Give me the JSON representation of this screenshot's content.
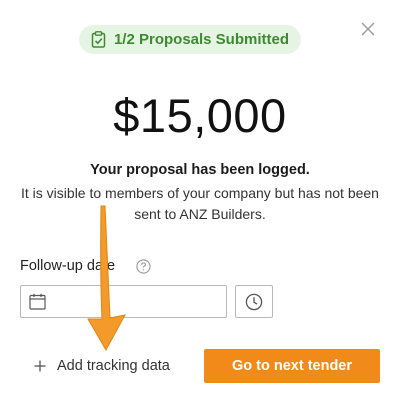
{
  "badge": {
    "text": "1/2 Proposals Submitted",
    "icon": "clipboard-check-icon",
    "color": "#3d8b30",
    "background": "#e6f5e3"
  },
  "amount": "$15,000",
  "message": {
    "title": "Your proposal has been logged.",
    "body": "It is visible to members of your company but has not been sent to ANZ Builders."
  },
  "followup": {
    "label": "Follow-up date",
    "help_icon": "question-circle-icon",
    "date_value": "",
    "calendar_icon": "calendar-icon",
    "time_icon": "clock-icon"
  },
  "actions": {
    "add_tracking": "Add tracking data",
    "next_tender": "Go to next tender"
  },
  "colors": {
    "accent": "#f28a1a",
    "annotation_arrow": "#f39a2b"
  }
}
